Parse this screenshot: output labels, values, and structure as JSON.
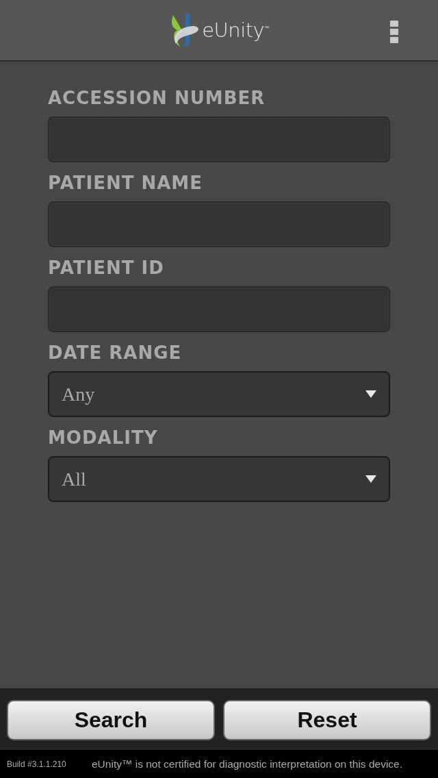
{
  "header": {
    "brand": "eUnity$^{™}$"
  },
  "fields": [
    {
      "kind": "text",
      "label": "ACCESSION NUMBER"
    },
    {
      "kind": "text",
      "label": "PATIENT NAME"
    },
    {
      "kind": "text",
      "label": "PATIENT ID"
    },
    {
      "kind": "select",
      "label": "DATE RANGE",
      "value": "Any"
    },
    {
      "kind": "select",
      "label": "MODALITY",
      "value": "All"
    }
  ],
  "buttons": [
    "Search",
    "Reset"
  ],
  "status_bar": {
    "build": "Build #3.1.1.210",
    "notice": "eUnity™ is not certified for diagnostic interpretation on this device."
  }
}
